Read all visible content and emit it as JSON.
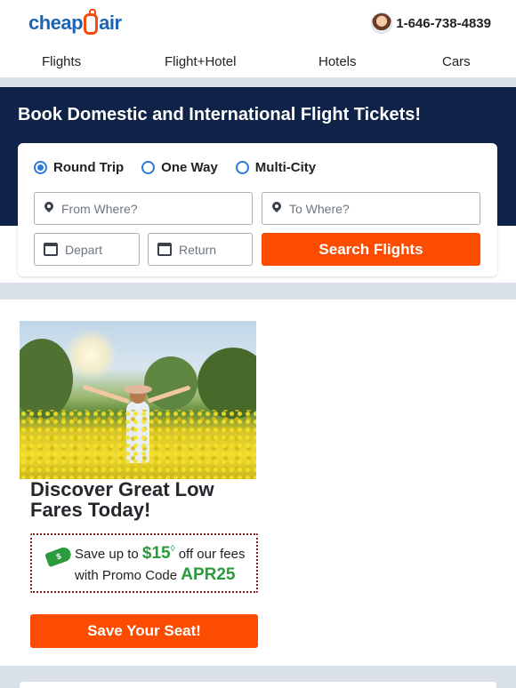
{
  "header": {
    "logo_text_left": "cheap",
    "logo_text_right": "air",
    "phone_number": "1-646-738-4839"
  },
  "nav": {
    "items": [
      {
        "label": "Flights"
      },
      {
        "label": "Flight+Hotel"
      },
      {
        "label": "Hotels"
      },
      {
        "label": "Cars"
      }
    ]
  },
  "hero": {
    "title": "Book Domestic and International Flight Tickets!"
  },
  "search": {
    "trip_types": [
      {
        "label": "Round Trip",
        "selected": true
      },
      {
        "label": "One Way",
        "selected": false
      },
      {
        "label": "Multi-City",
        "selected": false
      }
    ],
    "from_placeholder": "From Where?",
    "to_placeholder": "To Where?",
    "depart_placeholder": "Depart",
    "return_placeholder": "Return",
    "search_button": "Search Flights"
  },
  "promo": {
    "heading": "Discover Great Low Fares Today!",
    "tag_icon_text": "$",
    "line1_prefix": "Save up to ",
    "amount": "$15",
    "amount_suffix": "◊",
    "line1_suffix": " off our fees",
    "line2_prefix": "with Promo Code ",
    "code": "APR25",
    "cta": "Save Your Seat!"
  },
  "colors": {
    "brand_blue": "#1e64b4",
    "brand_orange": "#fc4c02",
    "hero_navy": "#0f2348",
    "promo_green": "#2a9a3c"
  }
}
